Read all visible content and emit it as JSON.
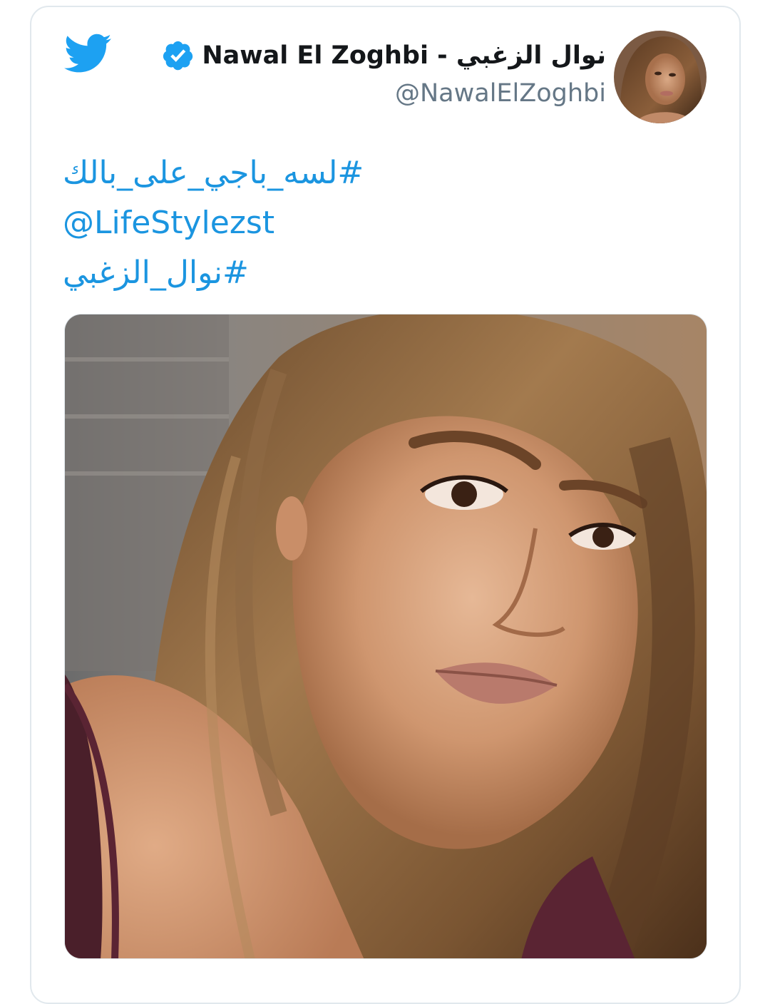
{
  "tweet": {
    "display_name": "Nawal El Zoghbi - نوال الزغبي",
    "handle": "@NawalElZoghbi",
    "lines": [
      "#لسه_باجي_على_بالك",
      "@LifeStylezst",
      "#نوال_الزغبي"
    ]
  },
  "icons": {
    "logo": "twitter-bird-icon",
    "verified": "verified-badge-icon"
  },
  "colors": {
    "link": "#1b95e0",
    "twitter_blue": "#1da1f2",
    "name": "#14171a",
    "handle": "#657786",
    "border": "#e1e8ed"
  }
}
